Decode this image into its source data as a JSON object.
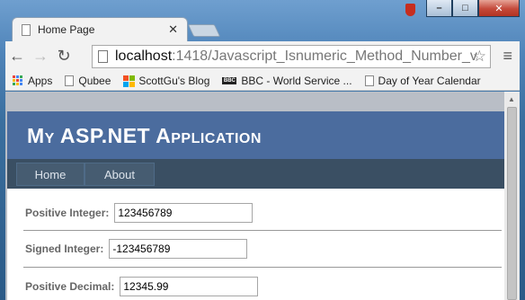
{
  "browser": {
    "tab_title": "Home Page",
    "tab_close": "✕",
    "url_host": "localhost",
    "url_path": ":1418/Javascript_Isnumeric_Method_Number_v",
    "bookmarks": [
      {
        "label": "Apps",
        "icon": "apps-grid-icon"
      },
      {
        "label": "Qubee",
        "icon": "page-icon"
      },
      {
        "label": "ScottGu's Blog",
        "icon": "windows-logo-icon"
      },
      {
        "label": "BBC - World Service ...",
        "icon": "bbc-logo-icon"
      },
      {
        "label": "Day of Year Calendar",
        "icon": "page-icon"
      }
    ],
    "window_buttons": {
      "minimize": "–",
      "maximize": "□",
      "close": "✕"
    }
  },
  "page": {
    "app_title": "My ASP.NET Application",
    "nav": [
      "Home",
      "About"
    ],
    "fields": [
      {
        "label": "Positive Integer:",
        "value": "123456789"
      },
      {
        "label": "Signed Integer:",
        "value": "-123456789"
      },
      {
        "label": "Positive Decimal:",
        "value": "12345.99"
      }
    ]
  },
  "colors": {
    "header_bg": "#4b6c9e",
    "nav_bg": "#3a4f63",
    "nav_item_bg": "#465c71"
  }
}
